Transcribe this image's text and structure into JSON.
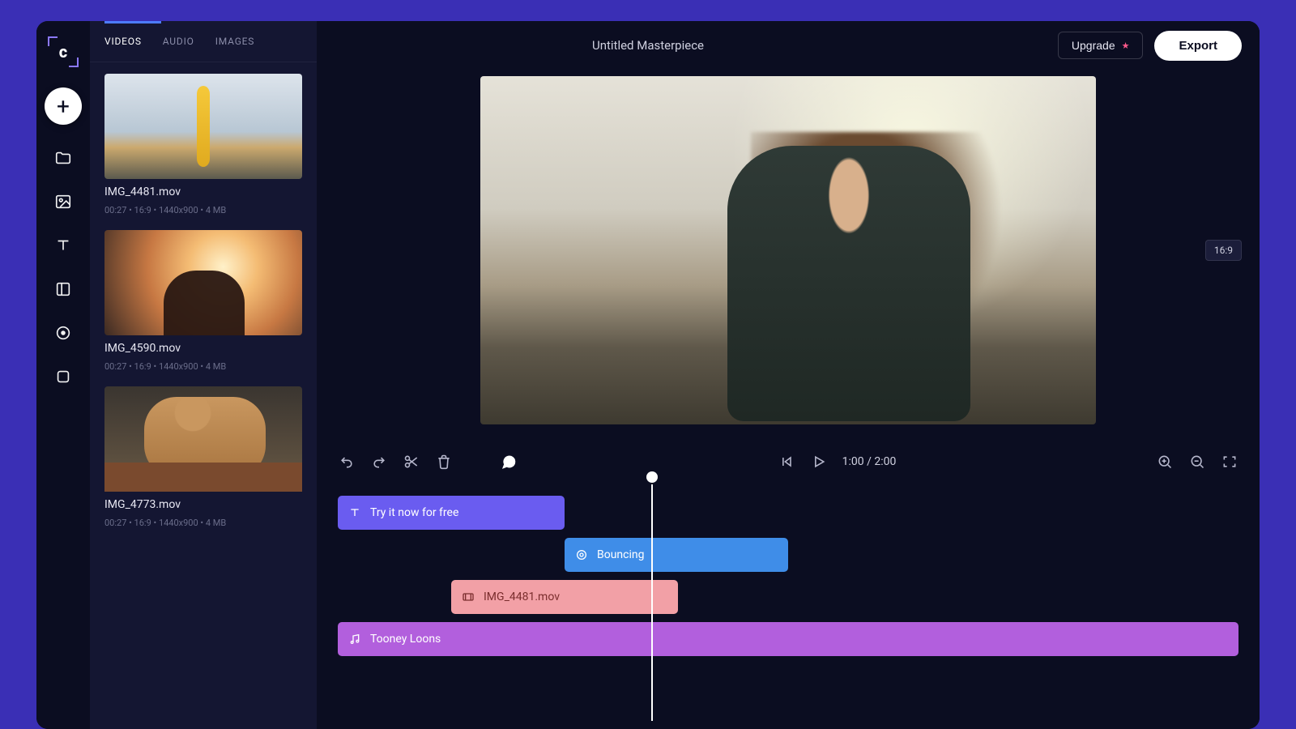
{
  "header": {
    "project_title": "Untitled Masterpiece",
    "upgrade_label": "Upgrade",
    "export_label": "Export"
  },
  "media_tabs": {
    "videos": "VIDEOS",
    "audio": "AUDIO",
    "images": "IMAGES",
    "active": "videos"
  },
  "media": [
    {
      "name": "IMG_4481.mov",
      "meta": "00:27  •  16:9  •  1440x900  •  4 MB"
    },
    {
      "name": "IMG_4590.mov",
      "meta": "00:27  •  16:9  •  1440x900  •  4 MB"
    },
    {
      "name": "IMG_4773.mov",
      "meta": "00:27  •  16:9  •  1440x900  •  4 MB"
    }
  ],
  "preview": {
    "aspect_label": "16:9"
  },
  "playback": {
    "current": "1:00",
    "total": "2:00",
    "separator": " / "
  },
  "timeline": {
    "tracks": [
      {
        "kind": "text",
        "label": "Try it now for free"
      },
      {
        "kind": "effect",
        "label": "Bouncing"
      },
      {
        "kind": "video",
        "label": "IMG_4481.mov"
      },
      {
        "kind": "audio",
        "label": "Tooney Loons"
      }
    ]
  },
  "rail_icons": [
    "add",
    "folder",
    "image",
    "text",
    "layout",
    "record",
    "shape"
  ],
  "control_icons": [
    "undo",
    "redo",
    "cut",
    "delete",
    "comment",
    "prev",
    "play",
    "zoom-in",
    "zoom-out",
    "fit"
  ],
  "colors": {
    "bg_outer": "#3a2fb5",
    "bg_app": "#0b0d21",
    "bg_panel": "#141632",
    "accent_purple": "#6a5cf0",
    "accent_blue": "#3f8de8",
    "accent_pink": "#f2a0a6",
    "accent_violet": "#b25fdd"
  }
}
